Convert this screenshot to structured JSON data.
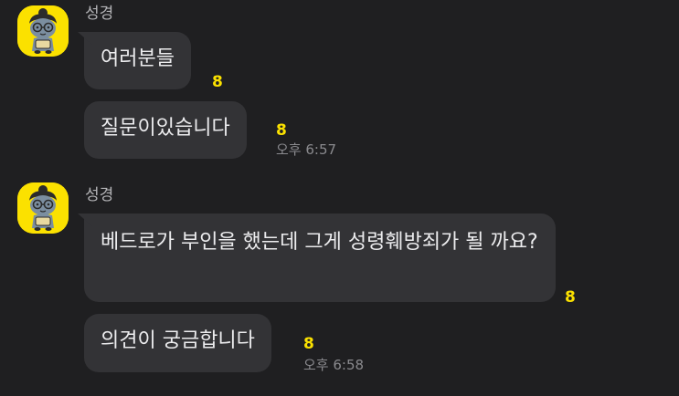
{
  "chat": {
    "groups": [
      {
        "sender": "성경",
        "avatar_icon": "cat-character-icon",
        "messages": [
          {
            "text": "여러분들",
            "unread": "8",
            "time": ""
          },
          {
            "text": "질문이있습니다",
            "unread": "8",
            "time": "오후 6:57"
          }
        ]
      },
      {
        "sender": "성경",
        "avatar_icon": "cat-character-icon",
        "messages": [
          {
            "text": "베드로가 부인을 했는데 그게 성령훼방죄가 될 까요?",
            "unread": "8",
            "time": ""
          },
          {
            "text": "의견이 궁금합니다",
            "unread": "8",
            "time": "오후 6:58"
          }
        ]
      }
    ]
  },
  "colors": {
    "background": "#1f1f21",
    "bubble": "#333336",
    "unread": "#fbe100",
    "avatar_bg": "#fbe100"
  }
}
